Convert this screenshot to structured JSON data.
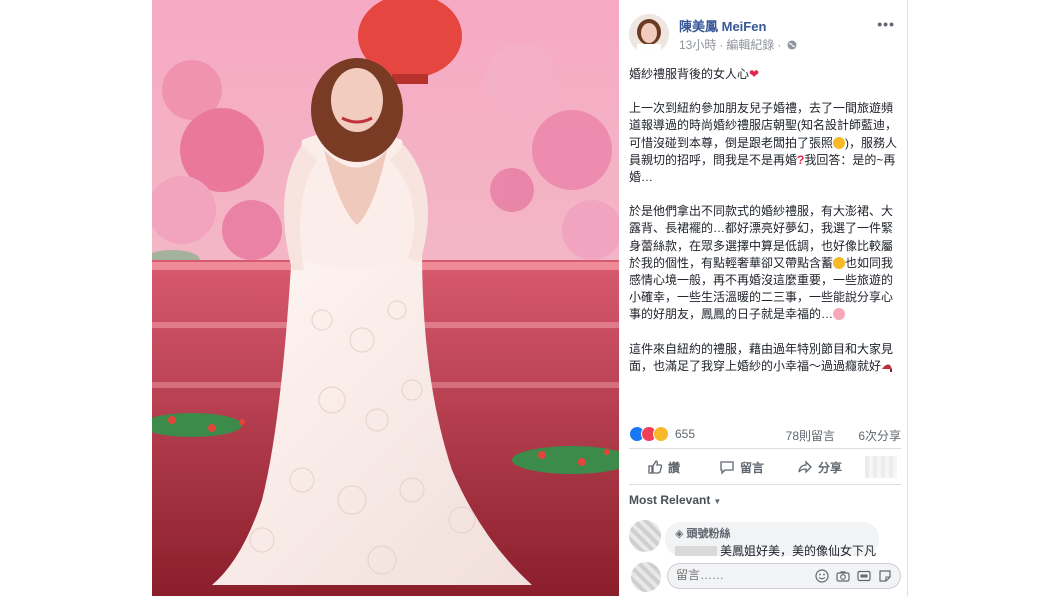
{
  "author": {
    "name": "陳美鳳 MeiFen",
    "time": "13小時",
    "edit_label": "編輯紀錄",
    "separator": "·"
  },
  "more_label": "•••",
  "post": {
    "paragraphs": [
      "婚紗禮服背後的女人心",
      "上一次到紐約參加朋友兒子婚禮，去了一間旅遊頻道報導過的時尚婚紗禮服店朝聖(知名設計師藍迪，可惜沒碰到本尊，倒是跟老闆拍了張照",
      "服務人員親切的招呼，問我是不是再婚",
      "我回答：是的~再婚…",
      "於是他們拿出不同款式的婚紗禮服，有大澎裙、大露背、長裙襬的…都好漂亮好夢幻，我選了一件緊身蕾絲款，在眾多選擇中算是低調，也好像比較屬於我的個性，有點輕奢華卻又帶點含蓄",
      "也如同我感情心境一般，再不再婚沒這麼重要，一些旅遊的小確幸，一些生活溫暖的二三事，一些能說分享心事的好朋友，鳳鳳的日子就是幸福的…",
      "這件來自紐約的禮服，藉由過年特別節目和大家見面，也滿足了我穿上婚紗的小幸福～過過癮就好"
    ],
    "paren_close": ")，"
  },
  "reactions": {
    "count": "655",
    "comments": "78則留言",
    "shares": "6次分享"
  },
  "actions": {
    "like": "讚",
    "comment": "留言",
    "share": "分享"
  },
  "sort_label": "Most Relevant",
  "comment": {
    "badge": "頭號粉絲",
    "text": "美鳳姐好美，美的像仙女下凡"
  },
  "compose": {
    "placeholder": "留言……"
  },
  "colors": {
    "link": "#385898",
    "like_blue": "#1877f2",
    "love_red": "#f33e58",
    "wow_yellow": "#f7b928"
  },
  "icons": [
    "globe-icon",
    "like-icon",
    "comment-icon",
    "share-icon",
    "emoji-icon",
    "camera-icon",
    "gif-icon",
    "sticker-icon"
  ]
}
